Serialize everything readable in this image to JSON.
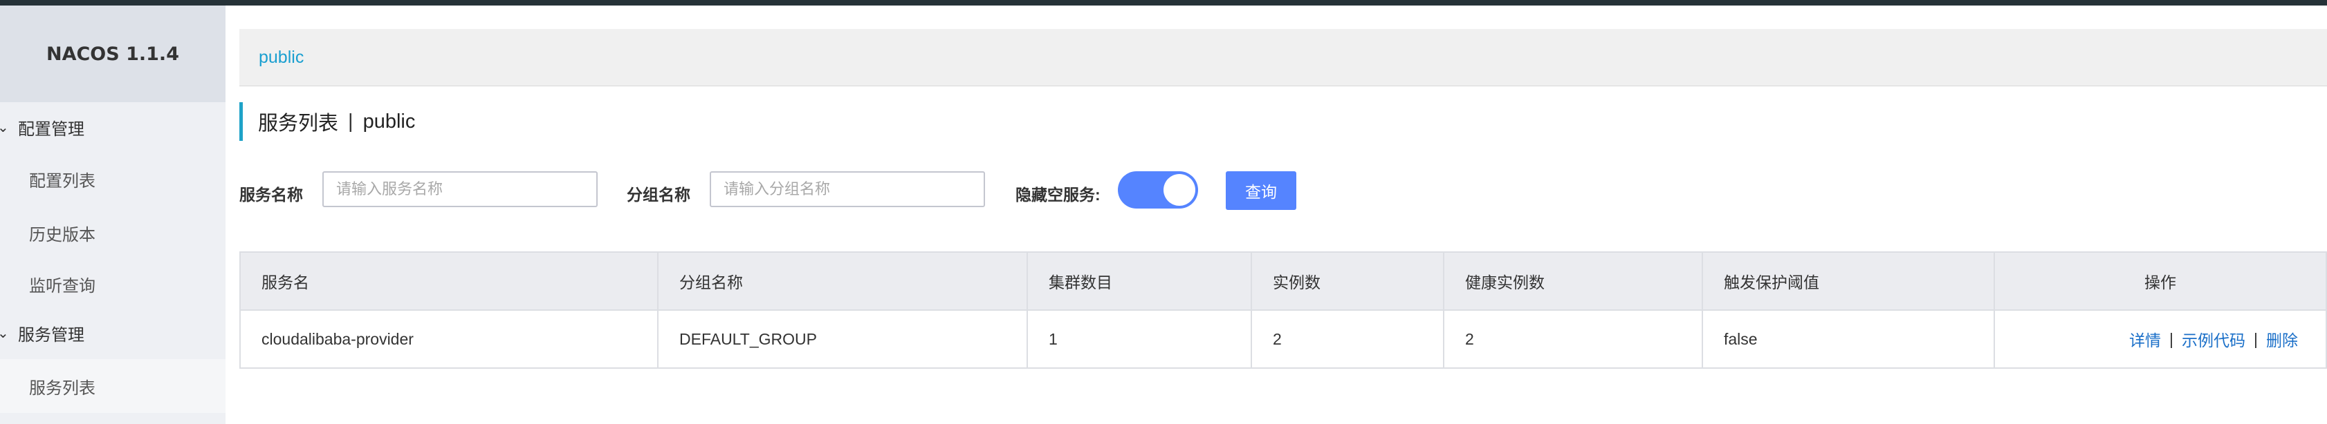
{
  "app": {
    "brand": "NACOS 1.1.4"
  },
  "sidebar": {
    "groups": [
      {
        "label": "配置管理",
        "items": [
          "配置列表",
          "历史版本",
          "监听查询"
        ]
      },
      {
        "label": "服务管理",
        "items": [
          "服务列表"
        ]
      }
    ],
    "active_item": "服务列表"
  },
  "breadcrumb": {
    "namespace": "public"
  },
  "page": {
    "title": "服务列表",
    "separator": "|",
    "namespace": "public"
  },
  "filters": {
    "service_name_label": "服务名称",
    "service_name_placeholder": "请输入服务名称",
    "service_name_value": "",
    "group_name_label": "分组名称",
    "group_name_placeholder": "请输入分组名称",
    "group_name_value": "",
    "hide_empty_label": "隐藏空服务:",
    "hide_empty_on": true,
    "query_button": "查询"
  },
  "table": {
    "columns": [
      "服务名",
      "分组名称",
      "集群数目",
      "实例数",
      "健康实例数",
      "触发保护阈值",
      "操作"
    ],
    "rows": [
      {
        "service": "cloudalibaba-provider",
        "group": "DEFAULT_GROUP",
        "clusters": "1",
        "instances": "2",
        "healthy": "2",
        "threshold": "false",
        "actions": [
          "详情",
          "示例代码",
          "删除"
        ]
      }
    ],
    "action_separator": "|"
  },
  "colors": {
    "accent": "#5584ff",
    "link": "#1a6fc8",
    "title_bar": "#1fa3c8",
    "topbar": "#263238"
  }
}
